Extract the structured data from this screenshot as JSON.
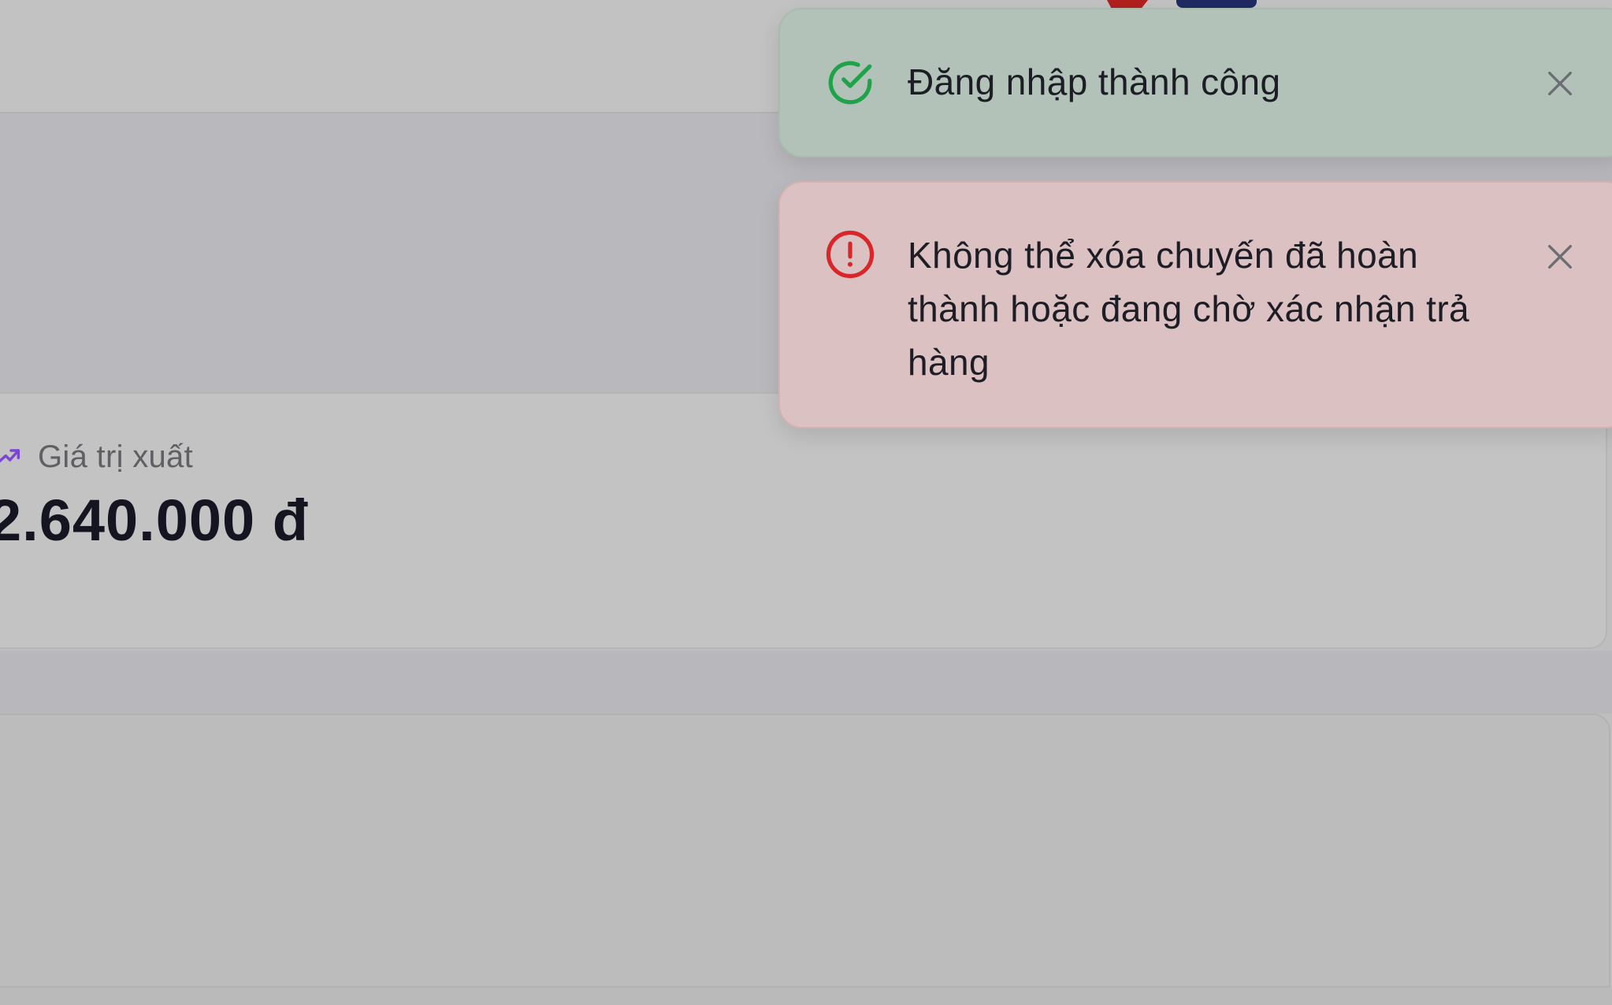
{
  "stat": {
    "label": "Giá trị xuất",
    "value": "2.640.000 đ",
    "icon": "trend-up-icon"
  },
  "toasts": [
    {
      "type": "success",
      "icon": "check-circle-icon",
      "message": "Đăng nhập thành công",
      "close_icon": "close-icon",
      "color": "#1fa34a"
    },
    {
      "type": "error",
      "icon": "alert-circle-icon",
      "message": "Không thể xóa chuyến đã hoàn thành hoặc đang chờ xác nhận trả hàng",
      "close_icon": "close-icon",
      "color": "#d8262b"
    }
  ],
  "colors": {
    "trend_icon": "#7b45d6",
    "text_primary": "#151522",
    "text_muted": "#5f5f64"
  }
}
